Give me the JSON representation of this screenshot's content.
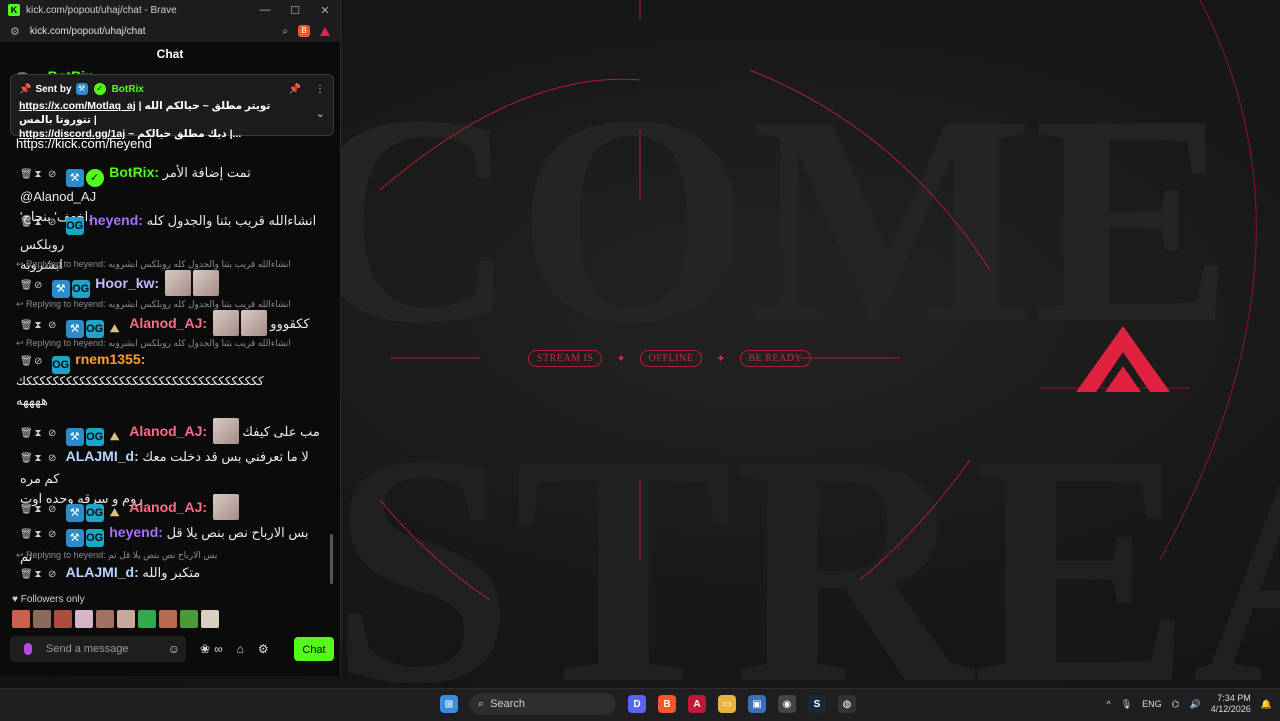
{
  "window": {
    "tab_title": "kick.com/popout/uhaj/chat - Brave",
    "url": "kick.com/popout/uhaj/chat",
    "favicon": "K",
    "controls": [
      "—",
      "☐",
      "✕"
    ]
  },
  "chat": {
    "header": "Chat",
    "pinned": {
      "sent_by": "Sent by",
      "bot": "BotRix",
      "line1_link": "https://x.com/Motlaq_aj",
      "line1_text": "| تويتر مطلق ~ حيالكم الله تتوروتا بالمس |",
      "line2_link": "https://discord.gg/1aj",
      "line2_text": "~ ديك مطلق حيالكم |...",
      "pin_icon": "📌",
      "more_icon": "⋮",
      "chevron": "⌄"
    },
    "top_link": "https://kick.com/heyend",
    "messages": [
      {
        "user": "BotRix",
        "text": "تمت إضافة الأمر @Alanod_AJ",
        "text2": "'اخعف' بنجاح."
      },
      {
        "user": "heyend",
        "text": "انشاءالله قريب بثنا والجدول كله روبلكس",
        "text2": "ابشروبه"
      },
      {
        "reply": "Replying to heyend: انشاءالله قريب بثنا والجدول كله روبلكس ابشروبه",
        "user": "Hoor_kw",
        "text": ""
      },
      {
        "reply": "Replying to heyend: انشاءالله قريب بثنا والجدول كله روبلكس ابشروبه",
        "user": "Alanod_AJ",
        "text": "ككقووو"
      },
      {
        "reply": "Replying to heyend: انشاءالله قريب بثنا والجدول كله روبلكس ابشروبه",
        "user": "rnem1355",
        "text": "ككككككككككككككككككككككككككككككككككككك",
        "text2": "ههههه"
      },
      {
        "user": "Alanod_AJ",
        "text": "مب على كيفك"
      },
      {
        "user": "ALAJMI_d",
        "text": "لا ما تعرفني بس قد دخلت معك كم مره",
        "text2": "روم و سرقه وحده اوت"
      },
      {
        "user": "Alanod_AJ",
        "text": ""
      },
      {
        "user": "heyend",
        "text": "بس الارباح نص بنص يلا قل تم"
      },
      {
        "reply": "Replying to heyend: بس الارباح نص بنص يلا قل تم",
        "user": "ALAJMI_d",
        "text": "متكبر والله"
      }
    ],
    "followers_only": "Followers only",
    "input_placeholder": "Send a message",
    "chat_button": "Chat",
    "infinity": "∞"
  },
  "wallpaper": {
    "pills": [
      "STREAM IS",
      "OFFLINE",
      "BE READY"
    ],
    "accent": "#d02a44"
  },
  "taskbar": {
    "search_label": "Search",
    "lang": "ENG",
    "time": "7:34 PM",
    "date": "4/12/2026",
    "chevron": "^"
  },
  "colors": {
    "kick_green": "#53fc18",
    "botrix": "#53fc18",
    "heyend": "#a970ff",
    "hoor": "#c9b8ff",
    "alanod": "#ff6b8a",
    "rnem": "#ff9e2c",
    "alajmi": "#b9d4ff"
  }
}
